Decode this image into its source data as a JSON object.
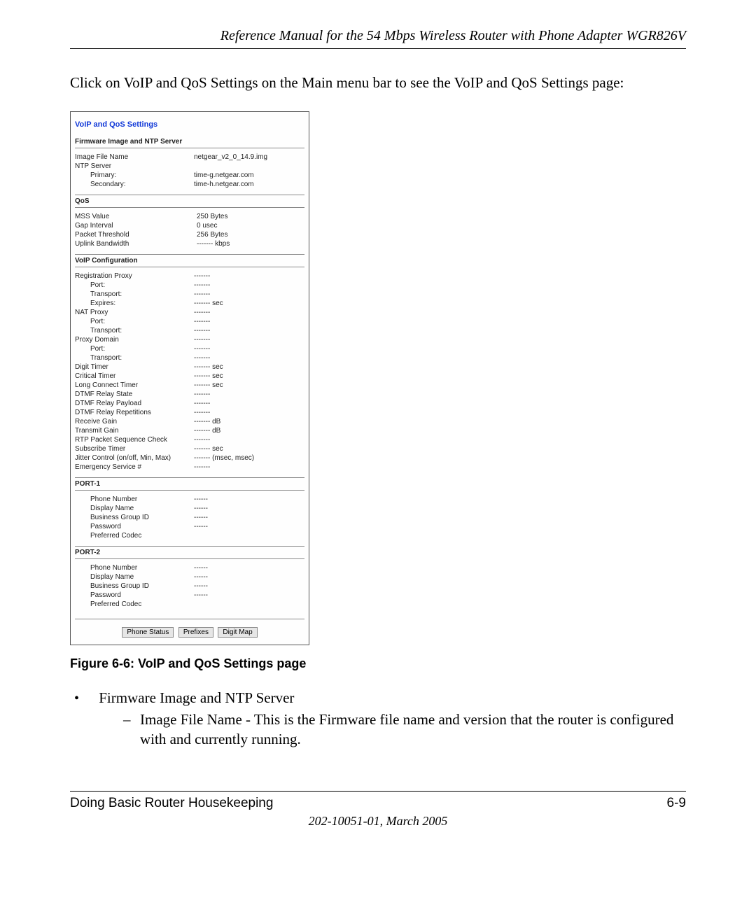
{
  "header": "Reference Manual for the 54 Mbps Wireless Router with Phone Adapter WGR826V",
  "intro": "Click on VoIP and QoS Settings on the Main menu bar to see the VoIP and QoS Settings page:",
  "screenshot": {
    "title": "VoIP and QoS Settings",
    "sections": {
      "firmware": {
        "head": "Firmware Image and NTP Server",
        "image_file_name_lbl": "Image File Name",
        "image_file_name_val": "netgear_v2_0_14.9.img",
        "ntp_server_lbl": "NTP Server",
        "primary_lbl": "Primary:",
        "primary_val": "time-g.netgear.com",
        "secondary_lbl": "Secondary:",
        "secondary_val": "time-h.netgear.com"
      },
      "qos": {
        "head": "QoS",
        "mss_lbl": "MSS Value",
        "mss_val": "250 Bytes",
        "gap_lbl": "Gap Interval",
        "gap_val": "0 usec",
        "pkt_lbl": "Packet Threshold",
        "pkt_val": "256 Bytes",
        "up_lbl": "Uplink Bandwidth",
        "up_val": "------- kbps"
      },
      "voip": {
        "head": "VoIP Configuration",
        "regproxy_lbl": "Registration Proxy",
        "regproxy_val": "-------",
        "regport_lbl": "Port:",
        "regport_val": "-------",
        "regtrans_lbl": "Transport:",
        "regtrans_val": "-------",
        "regexp_lbl": "Expires:",
        "regexp_val": "------- sec",
        "natproxy_lbl": "NAT Proxy",
        "natproxy_val": "-------",
        "natport_lbl": "Port:",
        "natport_val": "-------",
        "nattrans_lbl": "Transport:",
        "nattrans_val": "-------",
        "pdomain_lbl": "Proxy Domain",
        "pdomain_val": "-------",
        "pdport_lbl": "Port:",
        "pdport_val": "-------",
        "pdtrans_lbl": "Transport:",
        "pdtrans_val": "-------",
        "digit_lbl": "Digit Timer",
        "digit_val": "------- sec",
        "crit_lbl": "Critical Timer",
        "crit_val": "------- sec",
        "long_lbl": "Long Connect Timer",
        "long_val": "------- sec",
        "dtmfstate_lbl": "DTMF Relay State",
        "dtmfstate_val": "-------",
        "dtmfpay_lbl": "DTMF Relay Payload",
        "dtmfpay_val": "-------",
        "dtmfrep_lbl": "DTMF Relay Repetitions",
        "dtmfrep_val": "-------",
        "rgain_lbl": "Receive Gain",
        "rgain_val": "------- dB",
        "tgain_lbl": "Transmit Gain",
        "tgain_val": "------- dB",
        "rtp_lbl": "RTP Packet Sequence Check",
        "rtp_val": "-------",
        "sub_lbl": "Subscribe Timer",
        "sub_val": "------- sec",
        "jitter_lbl": "Jitter Control (on/off, Min, Max)",
        "jitter_val": "------- (msec, msec)",
        "emerg_lbl": "Emergency Service #",
        "emerg_val": "-------"
      },
      "port1": {
        "head": "PORT-1",
        "phone_lbl": "Phone Number",
        "phone_val": "------",
        "disp_lbl": "Display Name",
        "disp_val": "------",
        "bg_lbl": "Business Group ID",
        "bg_val": "------",
        "pw_lbl": "Password",
        "pw_val": "------",
        "codec_lbl": "Preferred Codec",
        "codec_val": ""
      },
      "port2": {
        "head": "PORT-2",
        "phone_lbl": "Phone Number",
        "phone_val": "------",
        "disp_lbl": "Display Name",
        "disp_val": "------",
        "bg_lbl": "Business Group ID",
        "bg_val": "------",
        "pw_lbl": "Password",
        "pw_val": "------",
        "codec_lbl": "Preferred Codec",
        "codec_val": ""
      }
    },
    "buttons": {
      "phone_status": "Phone Status",
      "prefixes": "Prefixes",
      "digit_map": "Digit Map"
    }
  },
  "caption": "Figure 6-6:  VoIP and QoS Settings page",
  "bullets": {
    "outer1": "Firmware Image and NTP Server",
    "inner1": "Image File Name - This is the Firmware file name and version that the router is configured with and currently running."
  },
  "footer": {
    "left": "Doing Basic Router Housekeeping",
    "right": "6-9",
    "docnum": "202-10051-01, March 2005"
  }
}
